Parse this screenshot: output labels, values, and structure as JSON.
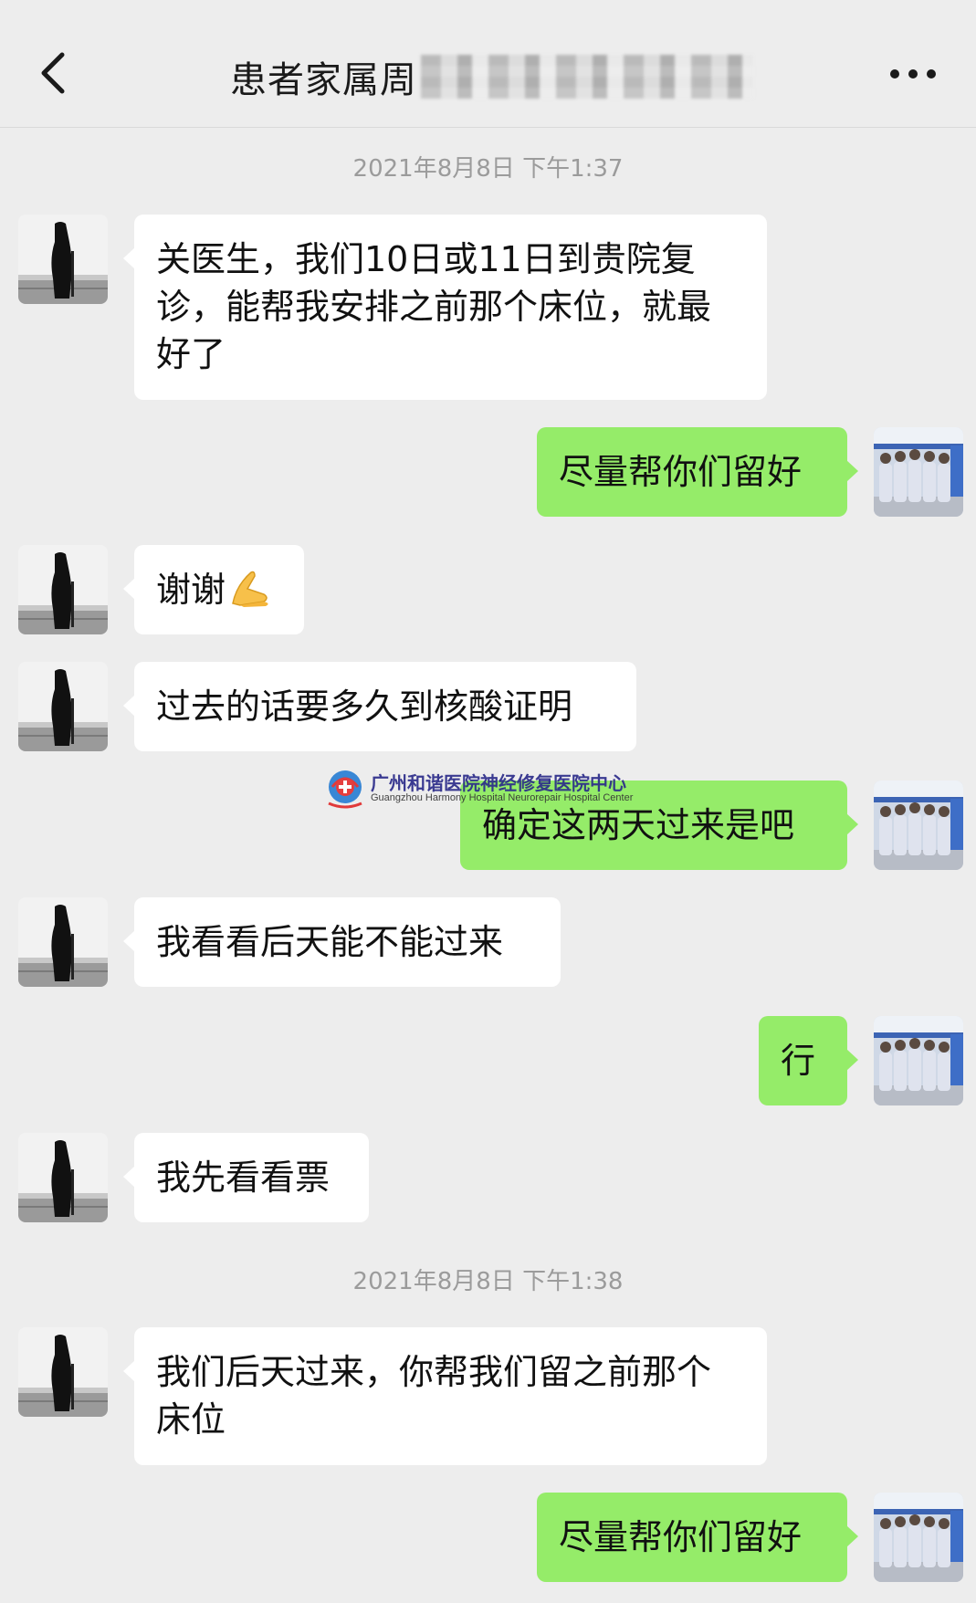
{
  "header": {
    "title": "患者家属周",
    "back_icon": "chevron-left-icon",
    "more_icon": "more-dots-icon"
  },
  "colors": {
    "background": "#ededed",
    "sent_bubble": "#95ec69",
    "received_bubble": "#ffffff",
    "timestamp_text": "#9b9b9b"
  },
  "timestamps": {
    "t1": "2021年8月8日 下午1:37",
    "t2": "2021年8月8日 下午1:38"
  },
  "messages": [
    {
      "from": "family",
      "text": "关医生，我们10日或11日到贵院复诊，能帮我安排之前那个床位，就最好了"
    },
    {
      "from": "doctor",
      "text": "尽量帮你们留好"
    },
    {
      "from": "family",
      "text": "谢谢",
      "emoji": "folded-hands-emoji"
    },
    {
      "from": "family",
      "text": "过去的话要多久到核酸证明"
    },
    {
      "from": "doctor",
      "text": "确定这两天过来是吧"
    },
    {
      "from": "family",
      "text": "我看看后天能不能过来"
    },
    {
      "from": "doctor",
      "text": "行"
    },
    {
      "from": "family",
      "text": "我先看看票"
    },
    {
      "from": "family",
      "text": "我们后天过来，你帮我们留之前那个床位"
    },
    {
      "from": "doctor",
      "text": "尽量帮你们留好"
    }
  ],
  "watermark": {
    "title": "广州和谐医院神经修复医院中心",
    "subtitle": "Guangzhou Harmony Hospital Neurorepair Hospital Center",
    "icon": "hospital-logo-icon"
  }
}
